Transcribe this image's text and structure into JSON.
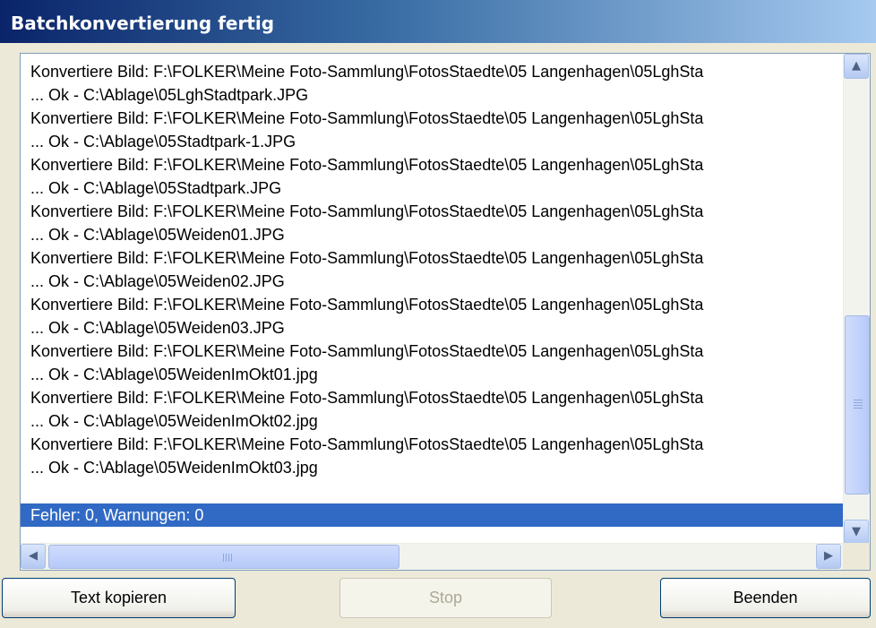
{
  "window": {
    "title": "Batchkonvertierung fertig"
  },
  "log": {
    "lines": [
      "Konvertiere Bild: F:\\FOLKER\\Meine Foto-Sammlung\\FotosStaedte\\05 Langenhagen\\05LghSta",
      "... Ok - C:\\Ablage\\05LghStadtpark.JPG",
      "Konvertiere Bild: F:\\FOLKER\\Meine Foto-Sammlung\\FotosStaedte\\05 Langenhagen\\05LghSta",
      "... Ok - C:\\Ablage\\05Stadtpark-1.JPG",
      "Konvertiere Bild: F:\\FOLKER\\Meine Foto-Sammlung\\FotosStaedte\\05 Langenhagen\\05LghSta",
      "... Ok - C:\\Ablage\\05Stadtpark.JPG",
      "Konvertiere Bild: F:\\FOLKER\\Meine Foto-Sammlung\\FotosStaedte\\05 Langenhagen\\05LghSta",
      "... Ok - C:\\Ablage\\05Weiden01.JPG",
      "Konvertiere Bild: F:\\FOLKER\\Meine Foto-Sammlung\\FotosStaedte\\05 Langenhagen\\05LghSta",
      "... Ok - C:\\Ablage\\05Weiden02.JPG",
      "Konvertiere Bild: F:\\FOLKER\\Meine Foto-Sammlung\\FotosStaedte\\05 Langenhagen\\05LghSta",
      "... Ok - C:\\Ablage\\05Weiden03.JPG",
      "Konvertiere Bild: F:\\FOLKER\\Meine Foto-Sammlung\\FotosStaedte\\05 Langenhagen\\05LghSta",
      "... Ok - C:\\Ablage\\05WeidenImOkt01.jpg",
      "Konvertiere Bild: F:\\FOLKER\\Meine Foto-Sammlung\\FotosStaedte\\05 Langenhagen\\05LghSta",
      "... Ok - C:\\Ablage\\05WeidenImOkt02.jpg",
      "Konvertiere Bild: F:\\FOLKER\\Meine Foto-Sammlung\\FotosStaedte\\05 Langenhagen\\05LghSta",
      "... Ok - C:\\Ablage\\05WeidenImOkt03.jpg",
      ""
    ],
    "summary": "Fehler: 0, Warnungen: 0"
  },
  "scrollbars": {
    "up_icon": "chevron-up-icon",
    "down_icon": "chevron-down-icon",
    "left_icon": "chevron-left-icon",
    "right_icon": "chevron-right-icon"
  },
  "buttons": {
    "copy": "Text kopieren",
    "stop": "Stop",
    "close": "Beenden"
  },
  "colors": {
    "title_gradient_start": "#0a246a",
    "title_gradient_end": "#a6caf0",
    "selection": "#316ac5"
  }
}
